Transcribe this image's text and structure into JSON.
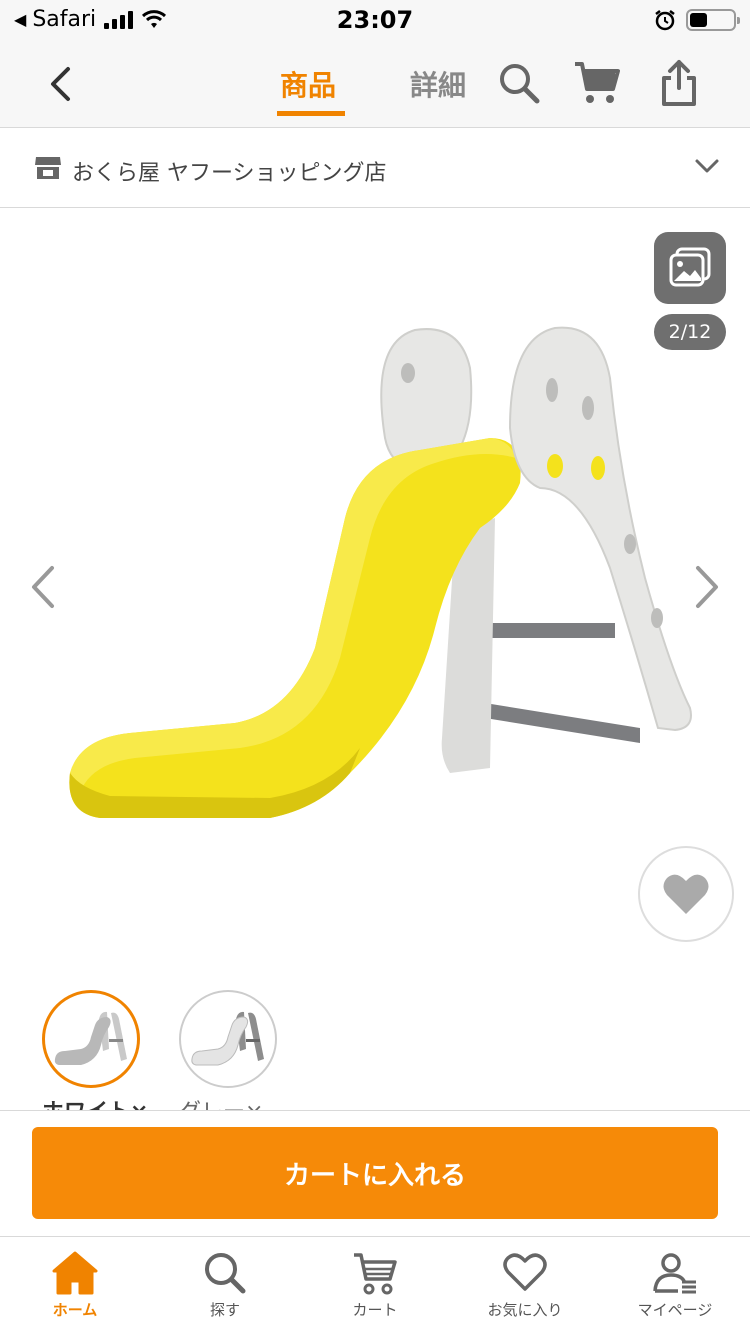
{
  "status_bar": {
    "carrier": "Safari",
    "time": "23:07"
  },
  "header": {
    "tabs": [
      {
        "label": "商品",
        "active": true
      },
      {
        "label": "詳細",
        "active": false
      }
    ],
    "icons": [
      "back-chevron-icon",
      "search-icon",
      "cart-icon",
      "share-icon"
    ]
  },
  "store": {
    "name": "おくら屋 ヤフーショッピング店",
    "icon": "store-icon"
  },
  "gallery": {
    "counter": "2/12",
    "current_index": 2,
    "total": 12
  },
  "variants": [
    {
      "label": "ホワイト×…",
      "selected": true
    },
    {
      "label": "グレー×…",
      "selected": false
    }
  ],
  "cta": {
    "label": "カートに入れる"
  },
  "tabbar": [
    {
      "label": "ホーム",
      "icon": "home-icon",
      "active": true
    },
    {
      "label": "探す",
      "icon": "search-icon",
      "active": false
    },
    {
      "label": "カート",
      "icon": "cart-icon",
      "active": false
    },
    {
      "label": "お気に入り",
      "icon": "heart-icon",
      "active": false
    },
    {
      "label": "マイページ",
      "icon": "user-icon",
      "active": false
    }
  ],
  "colors": {
    "accent": "#f08300",
    "cta": "#f68a08",
    "slide_yellow": "#f4e21c",
    "slide_frame": "#e6e6e4"
  }
}
